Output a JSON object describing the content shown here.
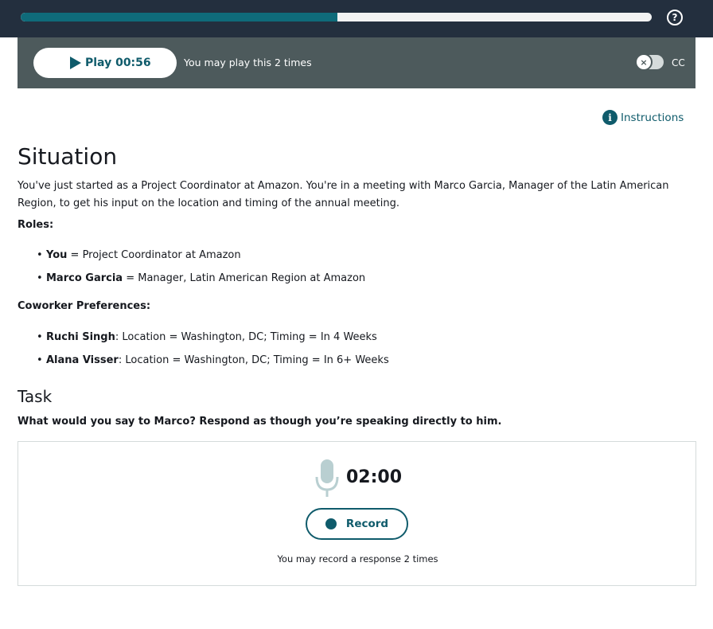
{
  "progress": {
    "fraction": 0.502
  },
  "header": {
    "help_icon": "question-circle-icon",
    "help_glyph": "?"
  },
  "player": {
    "play_label": "Play 00:56",
    "play_icon": "play-icon",
    "note": "You may play this 2 times",
    "cc_toggle_glyph": "×",
    "cc_label": "CC"
  },
  "instructions": {
    "label": "Instructions",
    "icon": "info-icon",
    "icon_glyph": "i"
  },
  "situation": {
    "title": "Situation",
    "intro": "You've just started as a Project Coordinator at Amazon. You're in a meeting with Marco Garcia, Manager of the Latin American Region, to get his input on the location and timing of the annual meeting.",
    "roles_label": "Roles:",
    "roles": [
      {
        "name": "You",
        "desc": " = Project Coordinator at Amazon"
      },
      {
        "name": "Marco Garcia",
        "desc": " = Manager, Latin American Region at Amazon"
      }
    ],
    "prefs_label": "Coworker Preferences:",
    "prefs": [
      {
        "name": "Ruchi Singh",
        "desc": ": Location = Washington, DC; Timing = In 4 Weeks"
      },
      {
        "name": "Alana Visser",
        "desc": ": Location = Washington, DC; Timing = In 6+ Weeks"
      }
    ]
  },
  "task": {
    "title": "Task",
    "prompt": "What would you say to Marco? Respond as though you’re speaking directly to him."
  },
  "recorder": {
    "mic_icon": "microphone-icon",
    "timer": "02:00",
    "record_label": "Record",
    "note": "You may record a response 2 times"
  },
  "colors": {
    "accent": "#0f5b6b",
    "topbar": "#232f3e",
    "player_bg": "#4d5a5c"
  }
}
